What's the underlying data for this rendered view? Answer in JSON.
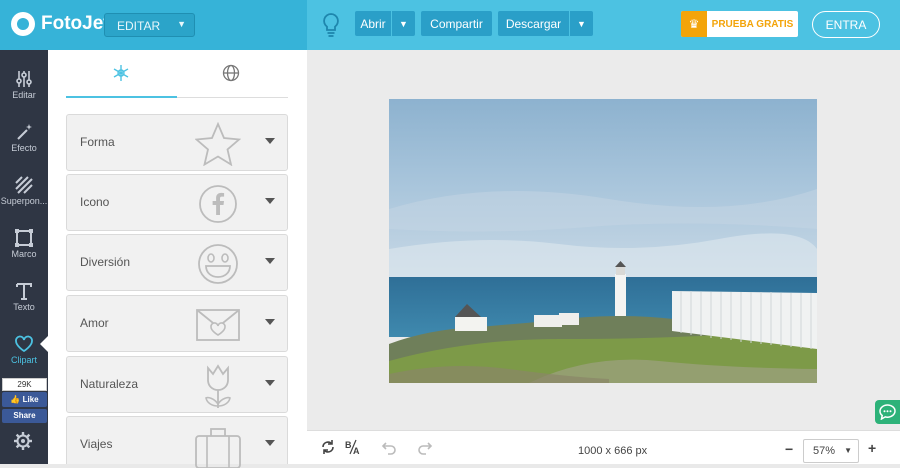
{
  "app": {
    "name": "FotoJet"
  },
  "toolbar": {
    "mode": "EDITAR",
    "open": "Abrir",
    "share": "Compartir",
    "download": "Descargar",
    "trial": "PRUEBA GRATIS",
    "login": "ENTRA"
  },
  "sidebar": {
    "items": [
      {
        "label": "Editar",
        "icon": "sliders-icon"
      },
      {
        "label": "Efecto",
        "icon": "magic-wand-icon"
      },
      {
        "label": "Superpon...",
        "icon": "overlay-icon"
      },
      {
        "label": "Marco",
        "icon": "frame-icon"
      },
      {
        "label": "Texto",
        "icon": "text-icon"
      },
      {
        "label": "Clipart",
        "icon": "heart-icon"
      }
    ],
    "facebook": {
      "count": "29K",
      "like": "Like",
      "share": "Share"
    }
  },
  "panel": {
    "tabs": [
      {
        "icon": "snowflake-icon"
      },
      {
        "icon": "globe-icon"
      }
    ],
    "categories": [
      {
        "label": "Forma",
        "icon": "star-icon"
      },
      {
        "label": "Icono",
        "icon": "facebook-icon"
      },
      {
        "label": "Diversión",
        "icon": "smiley-icon"
      },
      {
        "label": "Amor",
        "icon": "envelope-heart-icon"
      },
      {
        "label": "Naturaleza",
        "icon": "tulip-icon"
      },
      {
        "label": "Viajes",
        "icon": "suitcase-icon"
      }
    ]
  },
  "canvas": {
    "dimensions": "1000 x 666 px",
    "zoom": "57%"
  },
  "colors": {
    "accent": "#4cc2e2",
    "sidebar": "#2f3644",
    "trial": "#f3a40a",
    "chat": "#2db279"
  }
}
